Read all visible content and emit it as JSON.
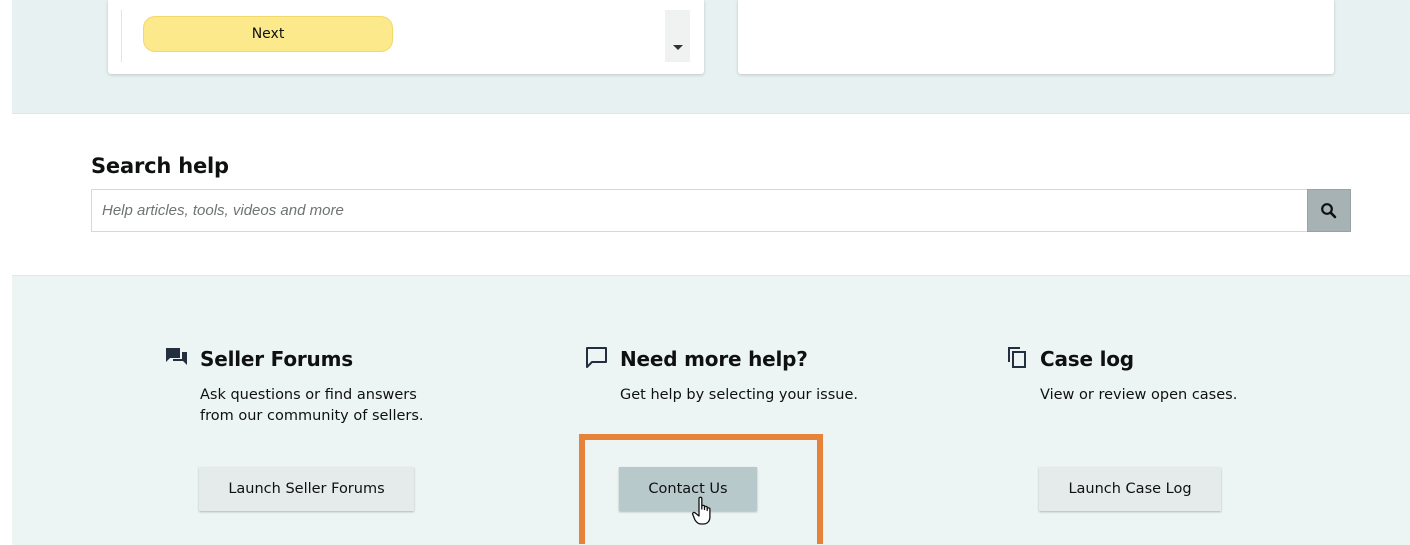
{
  "wizard": {
    "next_label": "Next",
    "dropdown_icon": "caret-down-icon"
  },
  "search": {
    "title": "Search help",
    "placeholder": "Help articles, tools, videos and more",
    "value": "",
    "button_icon": "search-icon"
  },
  "help_options": [
    {
      "icon": "forum-chat-icon",
      "title": "Seller Forums",
      "description": "Ask questions or find answers from our community of sellers.",
      "button_label": "Launch Seller Forums"
    },
    {
      "icon": "speech-bubble-icon",
      "title": "Need more help?",
      "description": "Get help by selecting your issue.",
      "button_label": "Contact Us"
    },
    {
      "icon": "copy-pages-icon",
      "title": "Case log",
      "description": "View or review open cases.",
      "button_label": "Launch Case Log"
    }
  ],
  "colors": {
    "next_button": "#fce98c",
    "highlight": "#e6823a",
    "band": "#e8f1f2",
    "search_button": "#a7b2b4"
  }
}
